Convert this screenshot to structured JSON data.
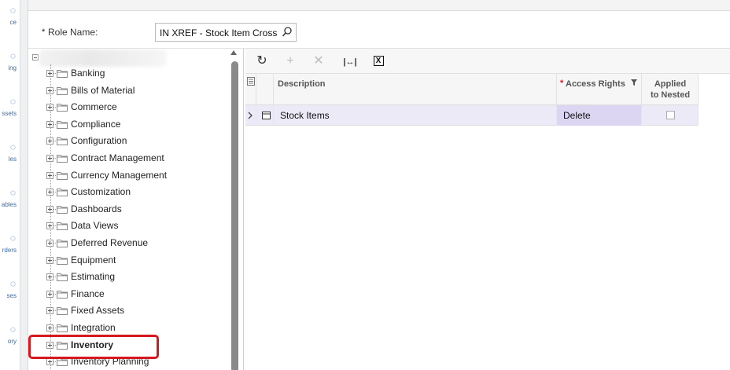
{
  "nav": {
    "items": [
      {
        "icon": "workspace-icon",
        "label": "ce"
      },
      {
        "icon": "banking-icon",
        "label": "ing"
      },
      {
        "icon": "assets-icon",
        "label": "ssets"
      },
      {
        "icon": "payables-icon",
        "label": "les"
      },
      {
        "icon": "receivables-icon",
        "label": "ables"
      },
      {
        "icon": "orders-icon",
        "label": "rders"
      },
      {
        "icon": "purchases-icon",
        "label": "ses"
      },
      {
        "icon": "inventory-icon",
        "label": "ory"
      }
    ]
  },
  "form": {
    "required_mark": "*",
    "role_label": "Role Name:",
    "role_value": "IN XREF - Stock Item Cross R"
  },
  "tree": {
    "items": [
      {
        "label": "Banking",
        "selected": false
      },
      {
        "label": "Bills of Material",
        "selected": false
      },
      {
        "label": "Commerce",
        "selected": false
      },
      {
        "label": "Compliance",
        "selected": false
      },
      {
        "label": "Configuration",
        "selected": false
      },
      {
        "label": "Contract Management",
        "selected": false
      },
      {
        "label": "Currency Management",
        "selected": false
      },
      {
        "label": "Customization",
        "selected": false
      },
      {
        "label": "Dashboards",
        "selected": false
      },
      {
        "label": "Data Views",
        "selected": false
      },
      {
        "label": "Deferred Revenue",
        "selected": false
      },
      {
        "label": "Equipment",
        "selected": false
      },
      {
        "label": "Estimating",
        "selected": false
      },
      {
        "label": "Finance",
        "selected": false
      },
      {
        "label": "Fixed Assets",
        "selected": false
      },
      {
        "label": "Integration",
        "selected": false
      },
      {
        "label": "Inventory",
        "selected": true
      },
      {
        "label": "Inventory Planning",
        "selected": false
      }
    ]
  },
  "toolbar": {
    "buttons": [
      {
        "name": "refresh-button",
        "icon": "refresh-icon",
        "glyph": "↻",
        "color": "#333333"
      },
      {
        "name": "add-row-button",
        "icon": "plus-icon",
        "glyph": "+",
        "color": "#bdbdbd"
      },
      {
        "name": "delete-row-button",
        "icon": "close-icon",
        "glyph": "✕",
        "color": "#bdbdbd"
      },
      {
        "name": "fit-to-screen-button",
        "icon": "fit-width-icon",
        "glyph": "|↔|",
        "color": "#333333"
      },
      {
        "name": "export-excel-button",
        "icon": "excel-icon",
        "glyph": "X",
        "color": "#111111"
      }
    ]
  },
  "grid": {
    "columns": {
      "description": "Description",
      "access_required": "*",
      "access_rights": "Access Rights",
      "applied_line1": "Applied",
      "applied_line2": "to Nested"
    },
    "rows": [
      {
        "description": "Stock Items",
        "access_rights": "Delete",
        "applied_to_nested": false
      }
    ]
  },
  "colors": {
    "accent": "#2f6fb6",
    "highlight": "#d7191f",
    "row_selected": "#eceaf7",
    "access_cell": "#dcd6f2"
  }
}
